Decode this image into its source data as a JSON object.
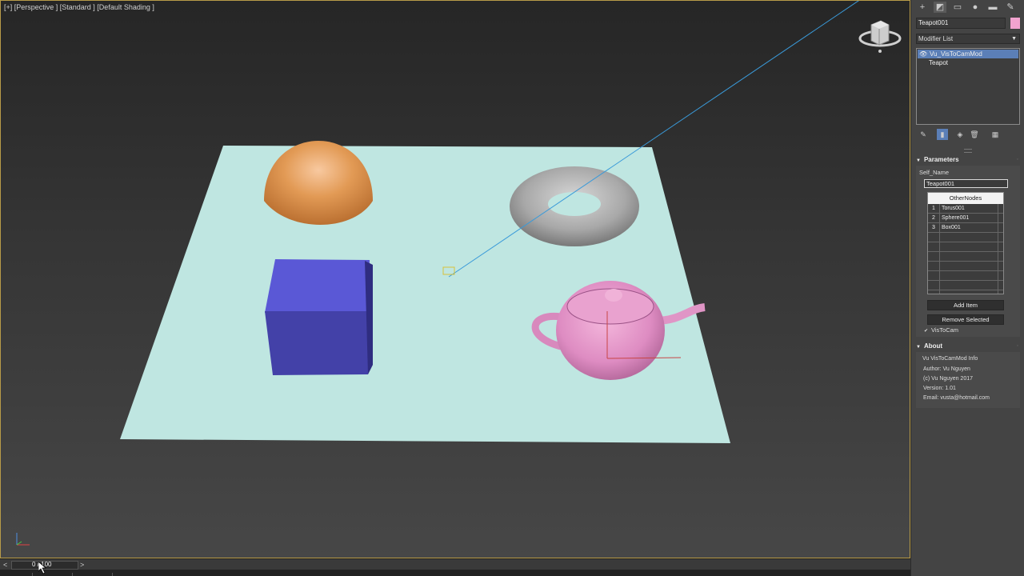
{
  "viewport": {
    "label": "[+] [Perspective ] [Standard ] [Default Shading ]"
  },
  "timeline": {
    "frame_text": "0 / 100",
    "prev_arrow": "<",
    "next_arrow": ">"
  },
  "panel": {
    "tabs": [
      "create-icon",
      "modify-icon",
      "hierarchy-icon",
      "motion-icon",
      "display-icon",
      "utilities-icon"
    ],
    "object_name": "Teapot001",
    "object_color": "#f2a3cf",
    "modifier_list_label": "Modifier List",
    "stack": [
      {
        "label": "Vu_VisToCamMod",
        "selected": true
      },
      {
        "label": "Teapot",
        "selected": false
      }
    ],
    "parameters": {
      "title": "Parameters",
      "self_name_label": "Self_Name",
      "self_name_value": "Teapot001",
      "other_nodes_header": "OtherNodes",
      "other_nodes": [
        {
          "index": "1",
          "name": "Torus001"
        },
        {
          "index": "2",
          "name": "Sphere001"
        },
        {
          "index": "3",
          "name": "Box001"
        }
      ],
      "add_item_label": "Add Item",
      "remove_selected_label": "Remove Selected",
      "vistocam_label": "VisToCam",
      "vistocam_checked": true
    },
    "about": {
      "title": "About",
      "lines": [
        "Vu VisToCamMod Info",
        "Author: Vu Nguyen",
        "(c) Vu Nguyen 2017",
        "Version: 1.01",
        "Email: vusta@hotmail.com"
      ]
    }
  }
}
